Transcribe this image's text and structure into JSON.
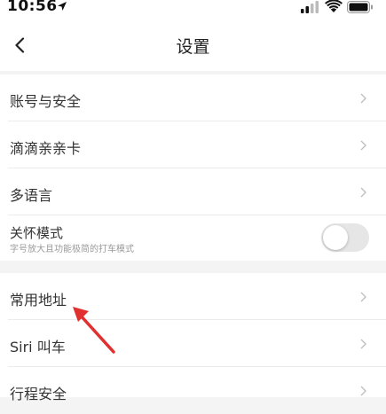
{
  "status_bar": {
    "time": "10:56",
    "icons": [
      "location-arrow-icon",
      "signal-icon",
      "wifi-icon",
      "battery-icon"
    ]
  },
  "nav": {
    "title": "设置",
    "back_icon": "chevron-left-icon"
  },
  "settings_group_1": [
    {
      "label": "账号与安全"
    },
    {
      "label": "滴滴亲亲卡"
    },
    {
      "label": "多语言"
    },
    {
      "label": "关怀模式",
      "subtitle": "字号放大且功能极简的打车模式",
      "toggle_on": false
    }
  ],
  "settings_group_2": [
    {
      "label": "常用地址"
    },
    {
      "label": "Siri 叫车"
    },
    {
      "label": "行程安全"
    }
  ],
  "colors": {
    "annotation_arrow": "#e03030",
    "toggle_off": "#e6e6e6",
    "background": "#f4f4f4"
  },
  "annotation": {
    "icon": "red-arrow-icon",
    "points_to": "常用地址"
  }
}
